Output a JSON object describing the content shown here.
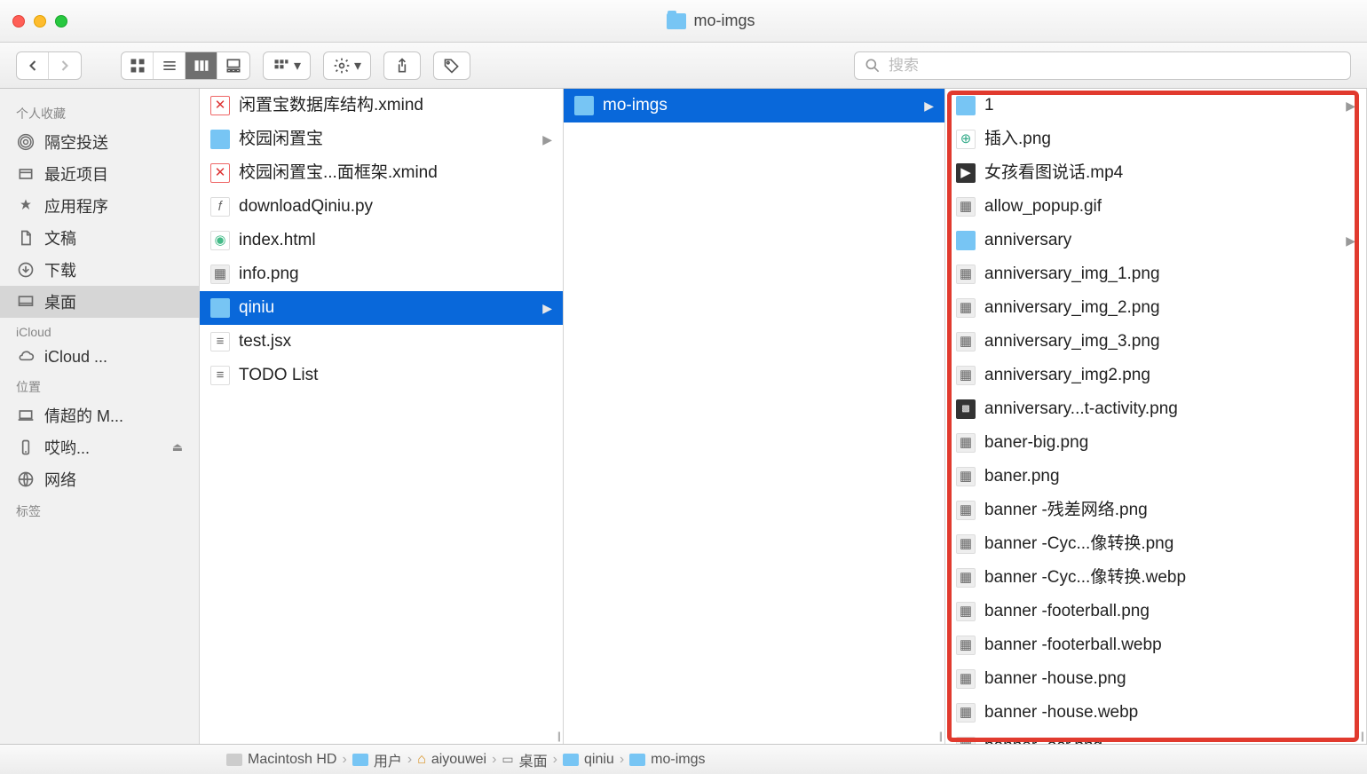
{
  "window": {
    "title": "mo-imgs"
  },
  "toolbar": {
    "view_modes": [
      "icon",
      "list",
      "column",
      "gallery"
    ],
    "active_view": "column",
    "search_placeholder": "搜索"
  },
  "sidebar": {
    "sections": [
      {
        "header": "个人收藏",
        "items": [
          {
            "label": "隔空投送",
            "icon": "airdrop"
          },
          {
            "label": "最近项目",
            "icon": "recent"
          },
          {
            "label": "应用程序",
            "icon": "apps"
          },
          {
            "label": "文稿",
            "icon": "docs"
          },
          {
            "label": "下载",
            "icon": "downloads"
          },
          {
            "label": "桌面",
            "icon": "desktop",
            "selected": true
          }
        ]
      },
      {
        "header": "iCloud",
        "items": [
          {
            "label": "iCloud ...",
            "icon": "cloud"
          }
        ]
      },
      {
        "header": "位置",
        "items": [
          {
            "label": "倩超的 M...",
            "icon": "laptop"
          },
          {
            "label": "哎哟...",
            "icon": "phone",
            "eject": true
          },
          {
            "label": "网络",
            "icon": "network"
          }
        ]
      },
      {
        "header": "标签",
        "items": []
      }
    ]
  },
  "columns": {
    "col1": [
      {
        "name": "闲置宝数据库结构.xmind",
        "icon": "xmind"
      },
      {
        "name": "校园闲置宝",
        "icon": "folder",
        "hasChildren": true
      },
      {
        "name": "校园闲置宝...面框架.xmind",
        "icon": "xmind"
      },
      {
        "name": "downloadQiniu.py",
        "icon": "py"
      },
      {
        "name": "index.html",
        "icon": "chrome"
      },
      {
        "name": "info.png",
        "icon": "img"
      },
      {
        "name": "qiniu",
        "icon": "folder",
        "hasChildren": true,
        "selected": true
      },
      {
        "name": "test.jsx",
        "icon": "txt"
      },
      {
        "name": "TODO List",
        "icon": "txt"
      }
    ],
    "col2": [
      {
        "name": "mo-imgs",
        "icon": "folder",
        "hasChildren": true,
        "selected": true
      }
    ],
    "col3": [
      {
        "name": "1",
        "icon": "folder",
        "hasChildren": true
      },
      {
        "name": "插入.png",
        "icon": "img-plus"
      },
      {
        "name": "女孩看图说话.mp4",
        "icon": "vid"
      },
      {
        "name": "allow_popup.gif",
        "icon": "img"
      },
      {
        "name": "anniversary",
        "icon": "folder",
        "hasChildren": true
      },
      {
        "name": "anniversary_img_1.png",
        "icon": "img"
      },
      {
        "name": "anniversary_img_2.png",
        "icon": "img"
      },
      {
        "name": "anniversary_img_3.png",
        "icon": "img"
      },
      {
        "name": "anniversary_img2.png",
        "icon": "img"
      },
      {
        "name": "anniversary...t-activity.png",
        "icon": "qr"
      },
      {
        "name": "baner-big.png",
        "icon": "img"
      },
      {
        "name": "baner.png",
        "icon": "img"
      },
      {
        "name": "banner -残差网络.png",
        "icon": "img"
      },
      {
        "name": "banner -Cyc...像转换.png",
        "icon": "img"
      },
      {
        "name": "banner -Cyc...像转换.webp",
        "icon": "img"
      },
      {
        "name": "banner -footerball.png",
        "icon": "img"
      },
      {
        "name": "banner -footerball.webp",
        "icon": "img"
      },
      {
        "name": "banner -house.png",
        "icon": "img"
      },
      {
        "name": "banner -house.webp",
        "icon": "img"
      },
      {
        "name": "banner -ocr.png",
        "icon": "img"
      }
    ]
  },
  "pathbar": [
    {
      "label": "Macintosh HD",
      "icon": "hd"
    },
    {
      "label": "用户",
      "icon": "fd"
    },
    {
      "label": "aiyouwei",
      "icon": "home"
    },
    {
      "label": "桌面",
      "icon": "desk"
    },
    {
      "label": "qiniu",
      "icon": "fd"
    },
    {
      "label": "mo-imgs",
      "icon": "fd"
    }
  ]
}
